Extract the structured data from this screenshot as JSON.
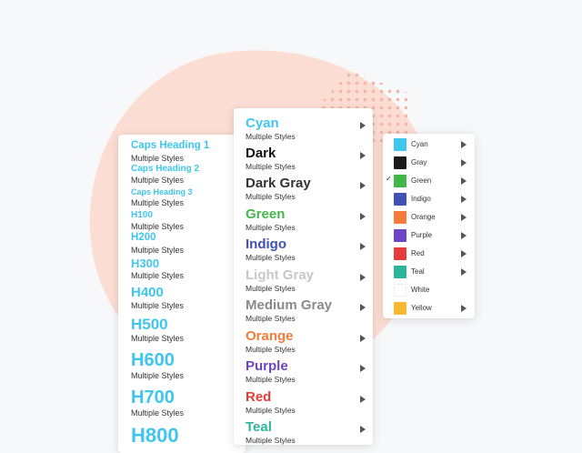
{
  "headings": [
    {
      "title": "Caps Heading 1",
      "subtitle": "Multiple Styles"
    },
    {
      "title": "Caps Heading 2",
      "subtitle": "Multiple Styles"
    },
    {
      "title": "Caps Heading 3",
      "subtitle": "Multiple Styles"
    },
    {
      "title": "H100",
      "subtitle": "Multiple Styles"
    },
    {
      "title": "H200",
      "subtitle": "Multiple Styles"
    },
    {
      "title": "H300",
      "subtitle": "Multiple Styles"
    },
    {
      "title": "H400",
      "subtitle": "Multiple Styles"
    },
    {
      "title": "H500",
      "subtitle": "Multiple Styles"
    },
    {
      "title": "H600",
      "subtitle": "Multiple Styles"
    },
    {
      "title": "H700",
      "subtitle": "Multiple Styles"
    },
    {
      "title": "H800",
      "subtitle": ""
    }
  ],
  "colors": [
    {
      "title": "Cyan",
      "subtitle": "Multiple Styles",
      "color": "#3fc6ee"
    },
    {
      "title": "Dark",
      "subtitle": "Multiple Styles",
      "color": "#111111"
    },
    {
      "title": "Dark Gray",
      "subtitle": "Multiple Styles",
      "color": "#333333"
    },
    {
      "title": "Green",
      "subtitle": "Multiple Styles",
      "color": "#43b649"
    },
    {
      "title": "Indigo",
      "subtitle": "Multiple Styles",
      "color": "#3f51b5"
    },
    {
      "title": "Light Gray",
      "subtitle": "Multiple Styles",
      "color": "#c8c8c8"
    },
    {
      "title": "Medium Gray",
      "subtitle": "Multiple Styles",
      "color": "#8a8a8a"
    },
    {
      "title": "Orange",
      "subtitle": "Multiple Styles",
      "color": "#f47b39"
    },
    {
      "title": "Purple",
      "subtitle": "Multiple Styles",
      "color": "#6b45c6"
    },
    {
      "title": "Red",
      "subtitle": "Multiple Styles",
      "color": "#e53b3b"
    },
    {
      "title": "Teal",
      "subtitle": "Multiple Styles",
      "color": "#2bb59a"
    }
  ],
  "swatches": [
    {
      "label": "Cyan",
      "color": "#3fc6ee",
      "checked": false,
      "has_submenu": true
    },
    {
      "label": "Gray",
      "color": "#1a1a1a",
      "checked": false,
      "has_submenu": true
    },
    {
      "label": "Green",
      "color": "#43b649",
      "checked": true,
      "has_submenu": true
    },
    {
      "label": "Indigo",
      "color": "#3f51b5",
      "checked": false,
      "has_submenu": true
    },
    {
      "label": "Orange",
      "color": "#f47b39",
      "checked": false,
      "has_submenu": true
    },
    {
      "label": "Purple",
      "color": "#6b45c6",
      "checked": false,
      "has_submenu": true
    },
    {
      "label": "Red",
      "color": "#e53b3b",
      "checked": false,
      "has_submenu": true
    },
    {
      "label": "Teal",
      "color": "#2bb59a",
      "checked": false,
      "has_submenu": true
    },
    {
      "label": "White",
      "color": "#ffffff",
      "checked": false,
      "has_submenu": false
    },
    {
      "label": "Yellow",
      "color": "#f5b82e",
      "checked": false,
      "has_submenu": true
    }
  ],
  "check_glyph": "✓"
}
